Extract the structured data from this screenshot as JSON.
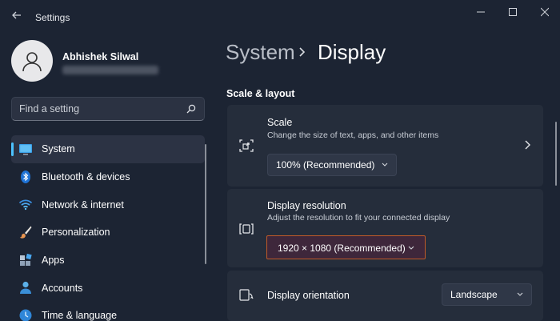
{
  "window": {
    "title": "Settings"
  },
  "user": {
    "name": "Abhishek Silwal"
  },
  "search": {
    "placeholder": "Find a setting"
  },
  "sidebar": {
    "items": [
      {
        "label": "System",
        "selected": true
      },
      {
        "label": "Bluetooth & devices"
      },
      {
        "label": "Network & internet"
      },
      {
        "label": "Personalization"
      },
      {
        "label": "Apps"
      },
      {
        "label": "Accounts"
      },
      {
        "label": "Time & language"
      }
    ]
  },
  "breadcrumb": {
    "parent": "System",
    "current": "Display"
  },
  "section": {
    "title": "Scale & layout"
  },
  "settings": {
    "scale": {
      "title": "Scale",
      "description": "Change the size of text, apps, and other items",
      "value": "100% (Recommended)"
    },
    "resolution": {
      "title": "Display resolution",
      "description": "Adjust the resolution to fit your connected display",
      "value": "1920 × 1080 (Recommended)"
    },
    "orientation": {
      "title": "Display orientation",
      "value": "Landscape"
    }
  },
  "colors": {
    "accent": "#4cc2ff",
    "background": "#1c2433",
    "card": "#252d3b",
    "highlight_border": "#c05a28"
  }
}
